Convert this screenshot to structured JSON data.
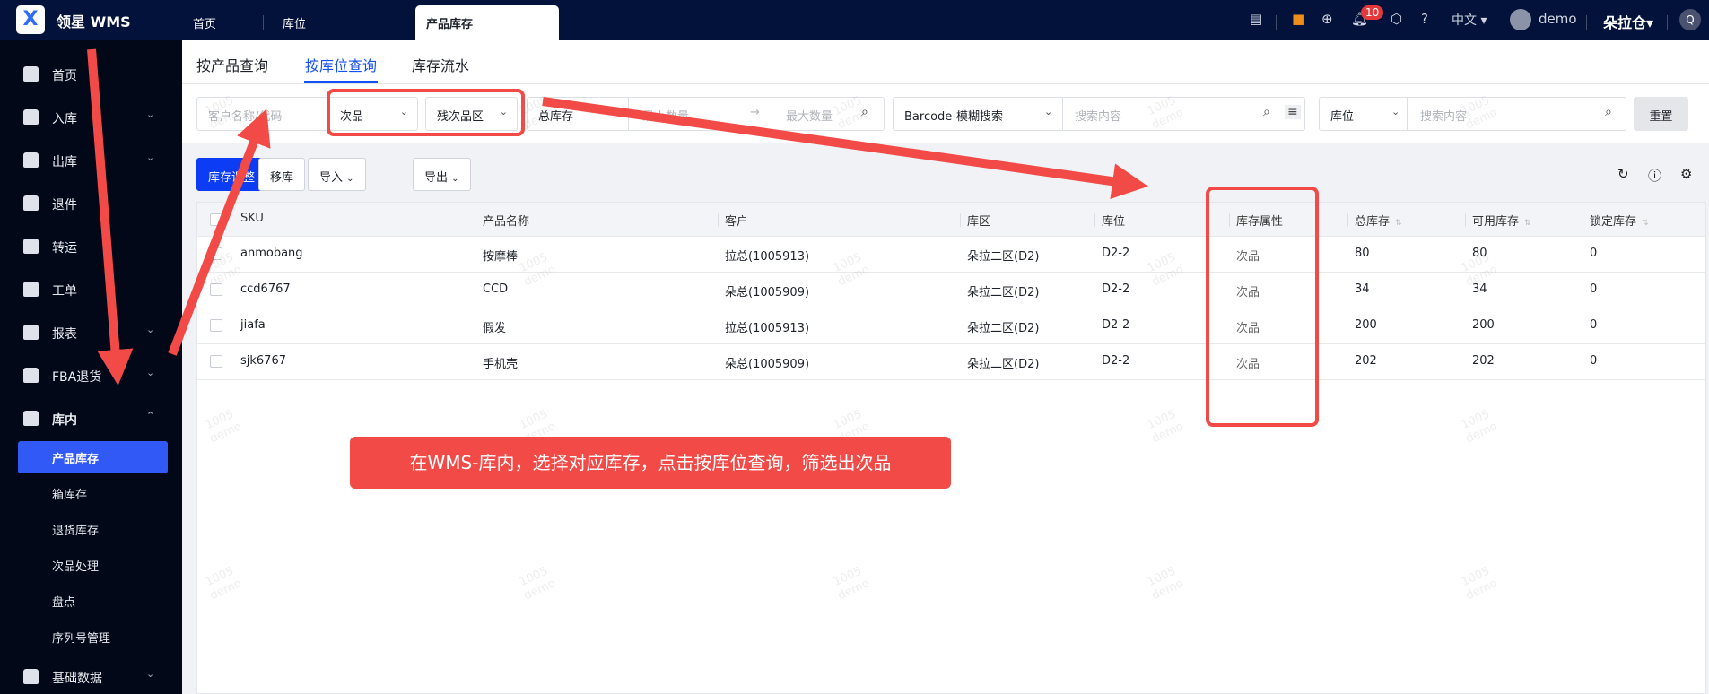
{
  "header": {
    "logo_text": "X",
    "app_name": "领星 WMS",
    "tabs": [
      {
        "label": "首页"
      },
      {
        "label": "库位"
      },
      {
        "label": "产品库存"
      }
    ],
    "language": "中文",
    "user": "demo",
    "warehouse": "朵拉仓",
    "notification_count": "10"
  },
  "sidebar": {
    "items": [
      {
        "label": "首页",
        "icon": "home-icon"
      },
      {
        "label": "入库",
        "icon": "inbound-icon"
      },
      {
        "label": "出库",
        "icon": "outbound-icon"
      },
      {
        "label": "退件",
        "icon": "return-icon"
      },
      {
        "label": "转运",
        "icon": "transfer-icon"
      },
      {
        "label": "工单",
        "icon": "ticket-icon"
      },
      {
        "label": "报表",
        "icon": "report-icon"
      },
      {
        "label": "FBA退货",
        "icon": "amazon-icon"
      },
      {
        "label": "库内",
        "icon": "warehouse-icon"
      }
    ],
    "subitems": [
      {
        "label": "产品库存",
        "active": true
      },
      {
        "label": "箱库存"
      },
      {
        "label": "退货库存"
      },
      {
        "label": "次品处理"
      },
      {
        "label": "盘点"
      },
      {
        "label": "序列号管理"
      }
    ],
    "bottom": {
      "label": "基础数据"
    }
  },
  "page_tabs": [
    {
      "label": "按产品查询"
    },
    {
      "label": "按库位查询",
      "active": true
    },
    {
      "label": "库存流水"
    }
  ],
  "filters": {
    "client_placeholder": "客户名称/代码",
    "attribute": "次品",
    "zone": "残次品区",
    "stock_type": "总库存",
    "min_placeholder": "最小数量",
    "max_placeholder": "最大数量",
    "barcode_mode": "Barcode-模糊搜索",
    "search_placeholder": "搜索内容",
    "location_type": "库位",
    "location_placeholder": "搜索内容",
    "reset": "重置"
  },
  "toolbar": {
    "adjust": "库存调整",
    "move": "移库",
    "import": "导入",
    "export": "导出"
  },
  "table": {
    "columns": [
      "SKU",
      "产品名称",
      "客户",
      "库区",
      "库位",
      "库存属性",
      "总库存",
      "可用库存",
      "锁定库存"
    ],
    "rows": [
      [
        "anmobang",
        "按摩棒",
        "拉总(1005913)",
        "朵拉二区(D2)",
        "D2-2",
        "次品",
        "80",
        "80",
        "0"
      ],
      [
        "ccd6767",
        "CCD",
        "朵总(1005909)",
        "朵拉二区(D2)",
        "D2-2",
        "次品",
        "34",
        "34",
        "0"
      ],
      [
        "jiafa",
        "假发",
        "拉总(1005913)",
        "朵拉二区(D2)",
        "D2-2",
        "次品",
        "200",
        "200",
        "0"
      ],
      [
        "sjk6767",
        "手机壳",
        "朵总(1005909)",
        "朵拉二区(D2)",
        "D2-2",
        "次品",
        "202",
        "202",
        "0"
      ]
    ]
  },
  "watermark": {
    "line1": "1005",
    "line2": "demo"
  },
  "annotation": {
    "text": "在WMS-库内，选择对应库存，点击按库位查询，筛选出次品",
    "color": "#f24a46"
  }
}
